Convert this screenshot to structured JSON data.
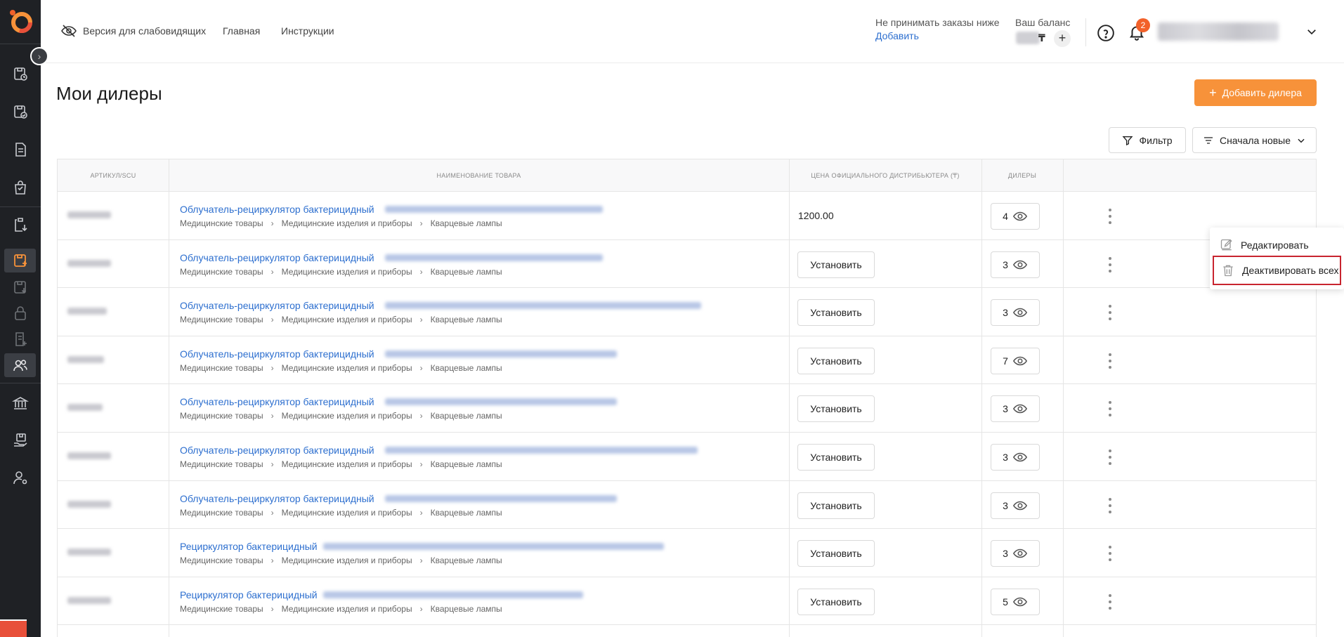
{
  "header": {
    "accessibility_label": "Версия для слабовидящих",
    "nav": [
      "Главная",
      "Инструкции"
    ],
    "orders_label": "Не принимать заказы ниже",
    "orders_action": "Добавить",
    "balance_label": "Ваш баланс",
    "balance_currency": "₸",
    "notifications_count": "2"
  },
  "page": {
    "title": "Мои дилеры",
    "add_button": "Добавить дилера",
    "filter_button": "Фильтр",
    "sort_button": "Сначала новые"
  },
  "table": {
    "columns": [
      "АРТИКУЛ/SCU",
      "НАИМЕНОВАНИЕ ТОВАРА",
      "ЦЕНА ОФИЦИАЛЬНОГО ДИСТРИБЬЮТЕРА (₸)",
      "ДИЛЕРЫ"
    ],
    "breadcrumb": [
      "Медицинские товары",
      "Медицинские изделия и приборы",
      "Кварцевые лампы"
    ],
    "set_label": "Установить",
    "rows": [
      {
        "name": "Облучатель-рециркулятор бактерицидный",
        "price": "1200.00",
        "dealers": "4"
      },
      {
        "name": "Облучатель-рециркулятор бактерицидный",
        "price": "",
        "dealers": "3"
      },
      {
        "name": "Облучатель-рециркулятор бактерицидный",
        "price": "",
        "dealers": "3"
      },
      {
        "name": "Облучатель-рециркулятор бактерицидный",
        "price": "",
        "dealers": "7"
      },
      {
        "name": "Облучатель-рециркулятор бактерицидный",
        "price": "",
        "dealers": "3"
      },
      {
        "name": "Облучатель-рециркулятор бактерицидный",
        "price": "",
        "dealers": "3"
      },
      {
        "name": "Облучатель-рециркулятор бактерицидный",
        "price": "",
        "dealers": "3"
      },
      {
        "name": "Рециркулятор бактерицидный",
        "price": "",
        "dealers": "3"
      },
      {
        "name": "Рециркулятор бактерицидный",
        "price": "",
        "dealers": "5"
      }
    ]
  },
  "menu": {
    "edit": "Редактировать",
    "deactivate_all": "Деактивировать всех"
  },
  "colors": {
    "accent": "#f7923a",
    "link": "#2d6fcf",
    "sidebar": "#1f2125",
    "badge": "#f2612a",
    "highlight": "#c8242f"
  }
}
